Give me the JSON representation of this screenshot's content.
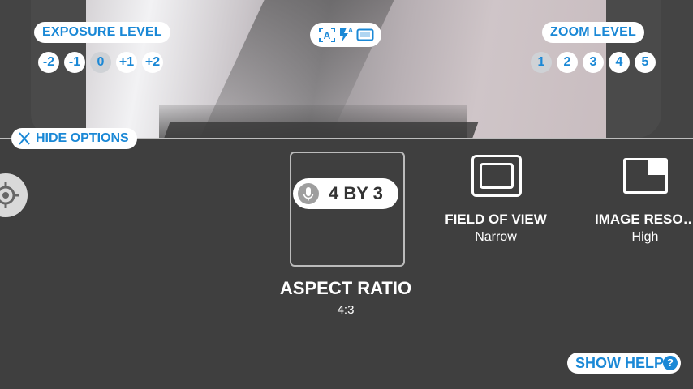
{
  "exposure": {
    "label": "EXPOSURE LEVEL",
    "levels": [
      "-2",
      "-1",
      "0",
      "+1",
      "+2"
    ],
    "selected": "0"
  },
  "zoom": {
    "label": "ZOOM LEVEL",
    "levels": [
      "1",
      "2",
      "3",
      "4",
      "5"
    ],
    "selected": "1"
  },
  "flash_modes": {
    "icons": [
      "auto-frame-icon",
      "flash-auto-icon",
      "screen-icon"
    ]
  },
  "hide_options": {
    "label": "HIDE OPTIONS",
    "icon": "close-icon"
  },
  "focus_button": {
    "icon": "crosshair-icon"
  },
  "aspect_ratio": {
    "voice_hint": "4 BY 3",
    "title": "ASPECT RATIO",
    "value": "4:3"
  },
  "field_of_view": {
    "title": "FIELD OF VIEW",
    "value": "Narrow",
    "icon": "field-of-view-icon"
  },
  "image_resolution": {
    "title": "IMAGE RESO…",
    "value": "High",
    "icon": "image-resolution-icon"
  },
  "help": {
    "label": "SHOW HELP",
    "icon_glyph": "?"
  },
  "colors": {
    "accent": "#1a88d6",
    "background": "#3f3f3f",
    "chip_selected": "#cfd2d6"
  }
}
